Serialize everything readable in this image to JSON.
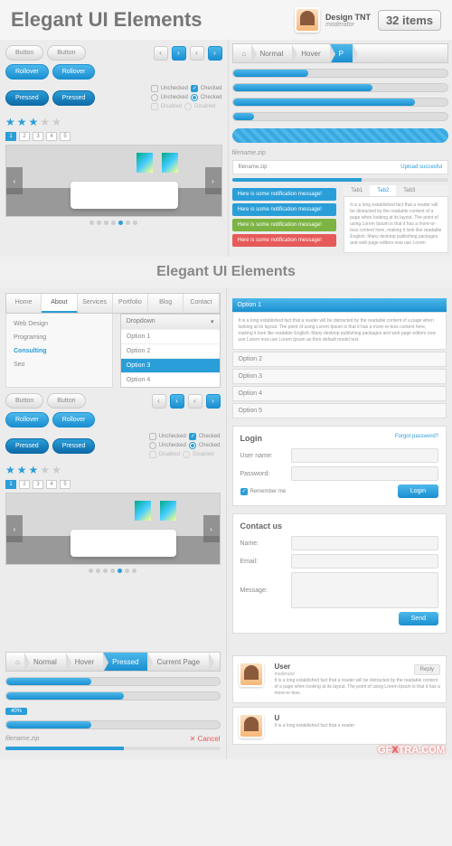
{
  "header": {
    "title": "Elegant UI Elements",
    "author": "Design TNT",
    "role": "moderator",
    "badge": "32 items"
  },
  "buttons": {
    "default": "Button",
    "rollover": "Rollover",
    "pressed": "Pressed"
  },
  "checkboxes": {
    "unchecked": "Unchecked",
    "checked": "Checked",
    "disabled": "Disabled"
  },
  "pagination": [
    "1",
    "2",
    "3",
    "4",
    "5"
  ],
  "subtitle": "Elegant UI Elements",
  "nav_tabs": [
    "Home",
    "About",
    "Services",
    "Portfolio",
    "Blog",
    "Contact"
  ],
  "submenu": [
    "Web Design",
    "Programing",
    "Consulting",
    "Seo"
  ],
  "dropdown": {
    "label": "Dropdown",
    "options": [
      "Option 1",
      "Option 2",
      "Option 3",
      "Option 4"
    ]
  },
  "breadcrumb": {
    "normal": "Normal",
    "hover": "Hover",
    "pressed": "Pressed",
    "current": "Current Page",
    "p": "P"
  },
  "progress": {
    "p1": 35,
    "p2": 65,
    "p3": 85,
    "p4": 40,
    "p5": 60,
    "p6": 55
  },
  "filename": "filename.zip",
  "upload": {
    "file": "filename.zip",
    "status": "Upload succesful",
    "cancel": "✕ Cancel"
  },
  "notifications": {
    "msg": "Here is some notification message!"
  },
  "mini_tabs": [
    "Tab1",
    "Tab2",
    "Tab3"
  ],
  "lorem": "It is a long established fact that a reader will be distracted by the readable content of a page when looking at its layout. The point of using Lorem Ipsum is that it has a more-or-less content here, making it look like readable English. Many desktop publishing packages and web page editors now use Lorem",
  "accordion": {
    "active": "Option 1",
    "body": "It is a long established fact that a reader will be distracted by the readable content of a page when looking at its layout. The point of using Lorem Ipsum is that it has a more-or-less content here, making it look like readable English. Many desktop publishing packages and web page editors now use Lorem now use Lorem Ipsum as their default model text.",
    "items": [
      "Option 2",
      "Option 3",
      "Option 4",
      "Option 5"
    ]
  },
  "login": {
    "title": "Login",
    "forgot": "Forgot password?",
    "user": "User name:",
    "pass": "Password:",
    "remember": "Remember me",
    "btn": "Login"
  },
  "contact": {
    "title": "Contact us",
    "name": "Name:",
    "email": "Email:",
    "message": "Message:",
    "send": "Send"
  },
  "comment": {
    "user": "User",
    "role": "moderator",
    "reply": "Reply",
    "text": "It is a long established fact that a reader will be distracted by the readable content of a page when looking at its layout. The point of using Lorem Ipsum is that it has a more-or-less."
  },
  "comment2": {
    "text": "It is a long established fact that a reader"
  },
  "percent": "40%",
  "watermark": "GFXTRA.COM"
}
